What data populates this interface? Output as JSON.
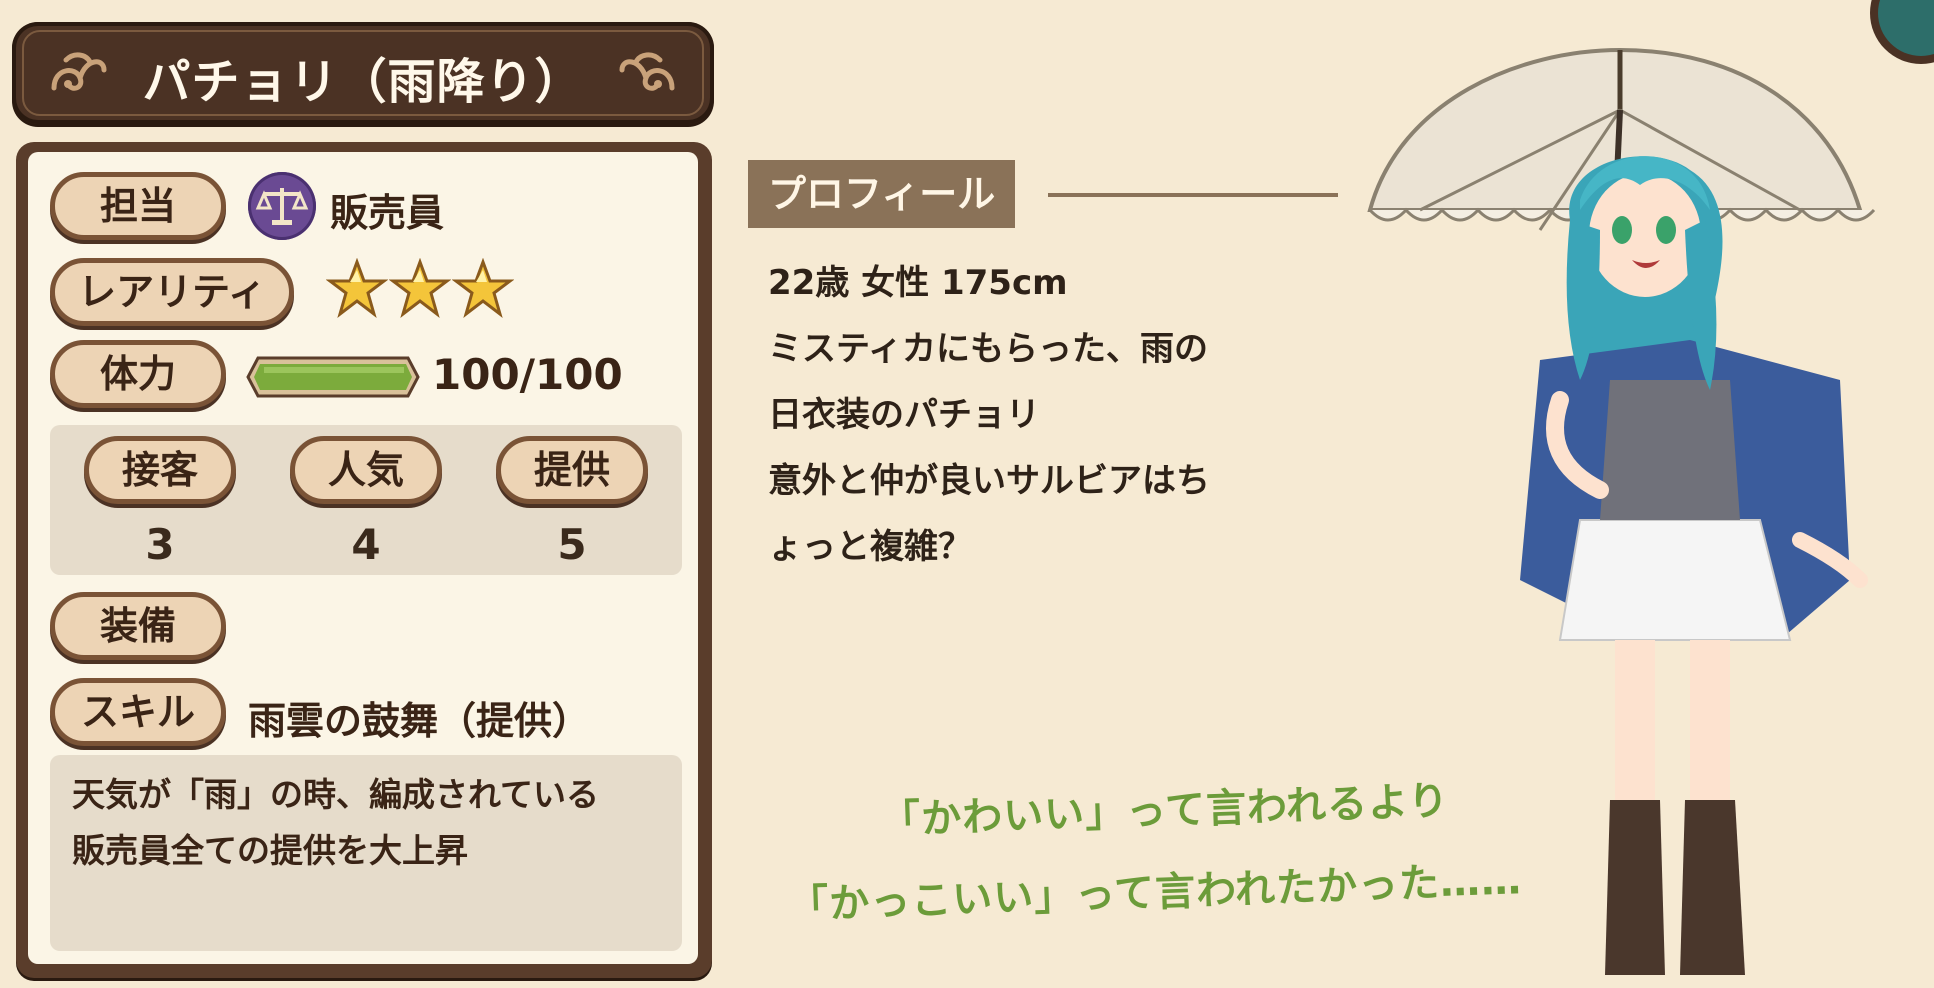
{
  "title": "パチョリ（雨降り）",
  "stats": {
    "role": {
      "label": "担当",
      "value": "販売員",
      "icon": "scales-icon"
    },
    "rarity": {
      "label": "レアリティ",
      "stars": 3,
      "max_stars": 3
    },
    "hp": {
      "label": "体力",
      "value": "100/100",
      "current": 100,
      "max": 100
    },
    "service": {
      "label": "接客",
      "value": "3"
    },
    "popularity": {
      "label": "人気",
      "value": "4"
    },
    "supply": {
      "label": "提供",
      "value": "5"
    },
    "equipment": {
      "label": "装備",
      "value": ""
    },
    "skill": {
      "label": "スキル",
      "name": "雨雲の鼓舞（提供）",
      "description_lines": [
        "天気が「雨」の時、編成されている",
        "販売員全ての提供を大上昇"
      ]
    }
  },
  "profile": {
    "header": "プロフィール",
    "lines": [
      "22歳 女性 175cm",
      "ミスティカにもらった、雨の",
      "日衣装のパチョリ",
      "意外と仲が良いサルビアはち",
      "ょっと複雑？"
    ]
  },
  "quote": {
    "line1": "「かわいい」って言われるより",
    "line2": "「かっこいい」って言われたかった……"
  },
  "colors": {
    "background": "#f6ead3",
    "panel": "#5a3d2b",
    "pill": "#edd4b5",
    "quote": "#6c9c3a",
    "hp_bar": "#7cab3c"
  }
}
